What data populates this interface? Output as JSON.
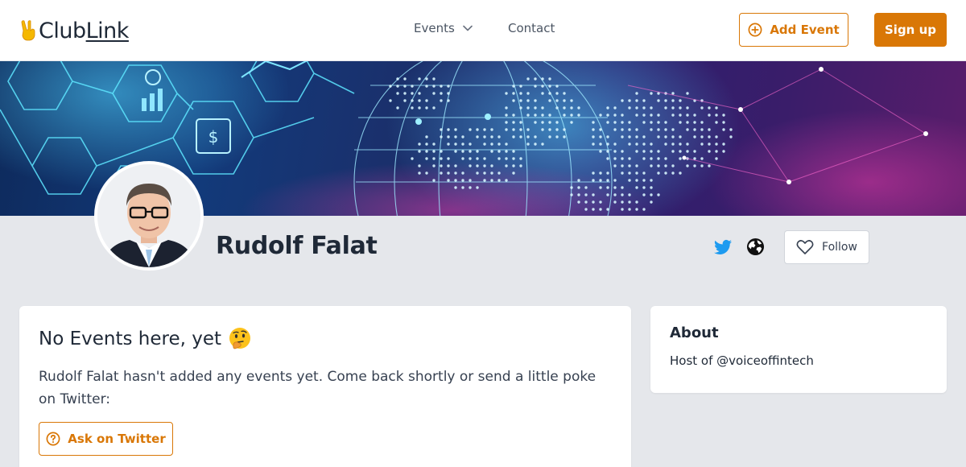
{
  "brand": {
    "name_prefix": "Club",
    "name_suffix": "Link",
    "accent_color": "#d97706",
    "logo_icon": "victory-hand-icon"
  },
  "nav": {
    "events_label": "Events",
    "contact_label": "Contact"
  },
  "header_actions": {
    "add_event_label": "Add Event",
    "signup_label": "Sign up"
  },
  "profile": {
    "name": "Rudolf Falat",
    "avatar_icon": "profile-photo",
    "social": [
      "twitter-icon",
      "globe-icon"
    ],
    "follow_label": "Follow"
  },
  "events_card": {
    "title": "No Events here, yet",
    "title_emoji": "thinking-face-icon",
    "description": "Rudolf Falat hasn't added any events yet. Come back shortly or send a little poke on Twitter:",
    "ask_button_label": "Ask on Twitter"
  },
  "about_card": {
    "title": "About",
    "text": "Host of @voiceoffintech"
  }
}
